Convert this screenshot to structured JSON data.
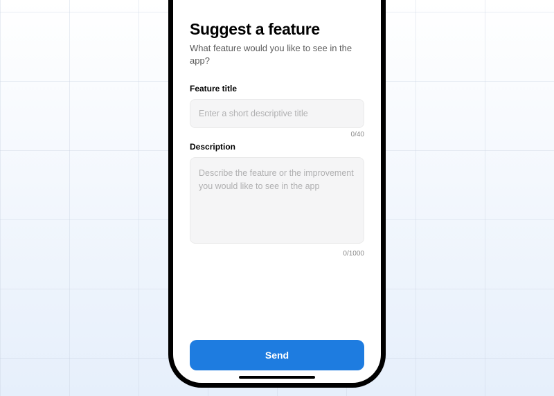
{
  "header": {
    "title": "Suggest a feature",
    "subtitle": "What feature would you like to see in the app?"
  },
  "form": {
    "featureTitle": {
      "label": "Feature title",
      "placeholder": "Enter a short descriptive title",
      "value": "",
      "counter": "0/40"
    },
    "description": {
      "label": "Description",
      "placeholder": "Describe the feature or the improvement you would like to see in the app",
      "value": "",
      "counter": "0/1000"
    }
  },
  "actions": {
    "sendLabel": "Send"
  }
}
